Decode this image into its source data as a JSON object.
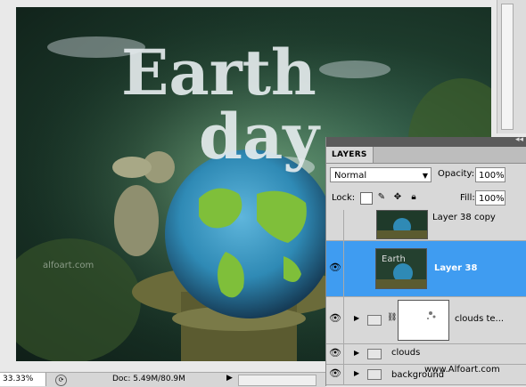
{
  "status_bar": {
    "zoom": "33.33%",
    "doc": "Doc: 5.49M/80.9M"
  },
  "canvas": {
    "artwork_title": [
      "Earth",
      "day"
    ],
    "watermark": "alfoart.com"
  },
  "layers_panel": {
    "tab": "LAYERS",
    "blend_mode": "Normal",
    "opacity_label": "Opacity:",
    "opacity_value": "100%",
    "lock_label": "Lock:",
    "fill_label": "Fill:",
    "fill_value": "100%",
    "layers": [
      {
        "name": "Layer 38 copy",
        "visible": false,
        "selected": false
      },
      {
        "name": "Layer 38",
        "visible": true,
        "selected": true
      },
      {
        "name": "clouds te...",
        "visible": true,
        "selected": false
      },
      {
        "name": "clouds",
        "visible": true,
        "selected": false
      },
      {
        "name": "background",
        "visible": true,
        "selected": false
      }
    ],
    "watermark": "www.Alfoart.com"
  },
  "colors": {
    "selection": "#3f9cf1",
    "panel_bg": "#d8d8d8",
    "globe_ocean": "#2f8ab5",
    "globe_land": "#7fbf3a"
  },
  "icons": {
    "visibility": "eye-icon",
    "expand": "triangle-right-icon",
    "group": "folder-icon",
    "link": "chain-icon"
  }
}
